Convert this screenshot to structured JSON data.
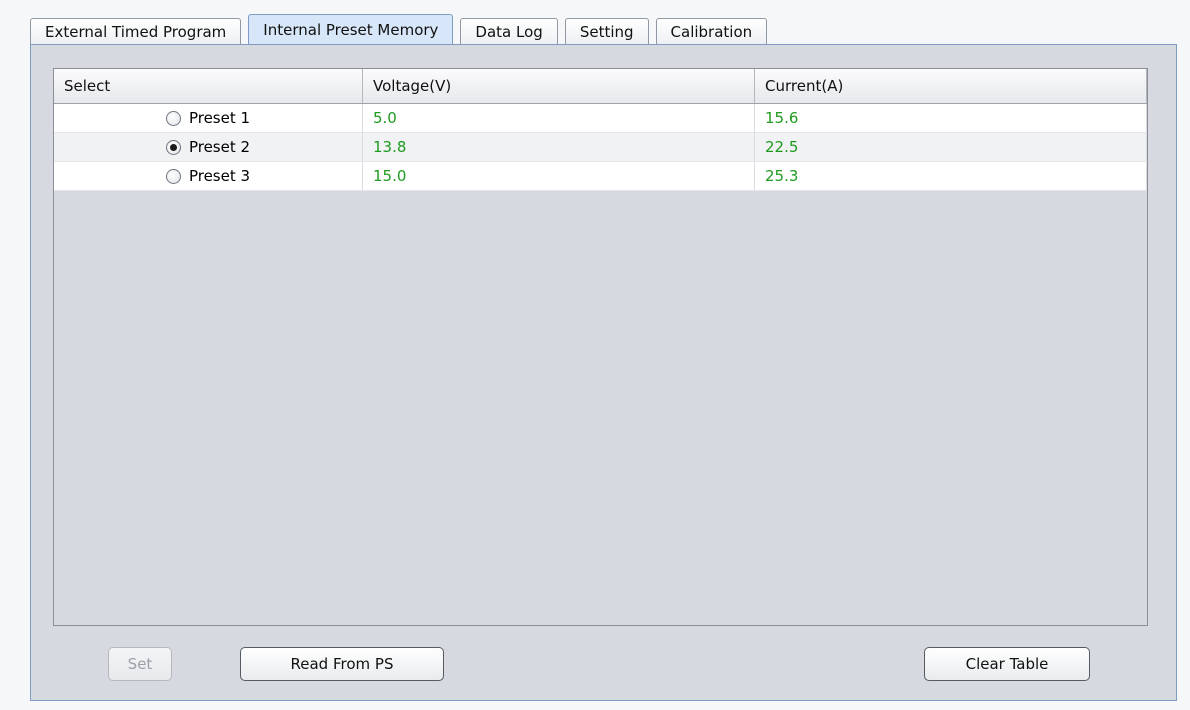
{
  "tabs": [
    {
      "label": "External Timed Program",
      "active": false
    },
    {
      "label": "Internal Preset Memory",
      "active": true
    },
    {
      "label": "Data Log",
      "active": false
    },
    {
      "label": "Setting",
      "active": false
    },
    {
      "label": "Calibration",
      "active": false
    }
  ],
  "table": {
    "headers": {
      "select": "Select",
      "voltage": "Voltage(V)",
      "current": "Current(A)"
    },
    "rows": [
      {
        "preset": "Preset 1",
        "selected": false,
        "voltage": "5.0",
        "current": "15.6"
      },
      {
        "preset": "Preset 2",
        "selected": true,
        "voltage": "13.8",
        "current": "22.5"
      },
      {
        "preset": "Preset 3",
        "selected": false,
        "voltage": "15.0",
        "current": "25.3"
      }
    ]
  },
  "buttons": {
    "set_label": "Set",
    "read_label": "Read From PS",
    "clear_label": "Clear Table"
  },
  "colors": {
    "active_tab": "#d7e6f8",
    "panel_bg": "#d6d9e0",
    "value_text": "#1e9a1e"
  }
}
